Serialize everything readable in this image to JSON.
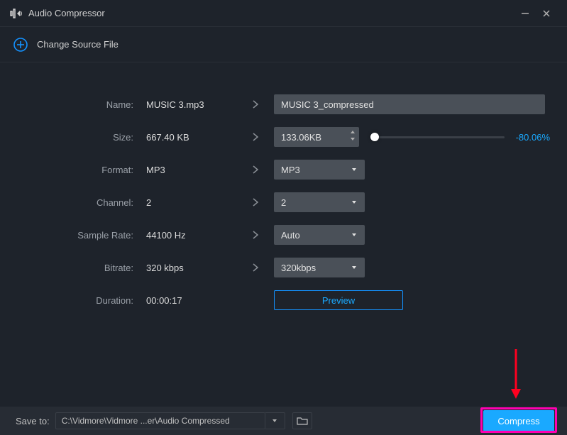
{
  "titlebar": {
    "title": "Audio Compressor"
  },
  "source": {
    "label": "Change Source File"
  },
  "fields": {
    "name_label": "Name:",
    "name_value": "MUSIC 3.mp3",
    "name_output": "MUSIC 3_compressed",
    "size_label": "Size:",
    "size_value": "667.40 KB",
    "size_output": "133.06KB",
    "size_percent": "-80.06%",
    "format_label": "Format:",
    "format_value": "MP3",
    "format_output": "MP3",
    "channel_label": "Channel:",
    "channel_value": "2",
    "channel_output": "2",
    "samplerate_label": "Sample Rate:",
    "samplerate_value": "44100 Hz",
    "samplerate_output": "Auto",
    "bitrate_label": "Bitrate:",
    "bitrate_value": "320 kbps",
    "bitrate_output": "320kbps",
    "duration_label": "Duration:",
    "duration_value": "00:00:17",
    "preview_label": "Preview"
  },
  "footer": {
    "saveto_label": "Save to:",
    "path": "C:\\Vidmore\\Vidmore ...er\\Audio Compressed",
    "compress_label": "Compress"
  }
}
